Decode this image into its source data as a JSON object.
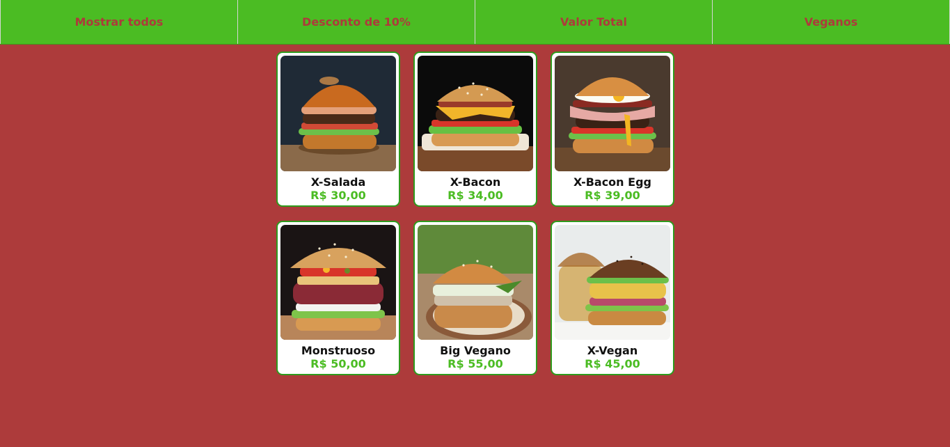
{
  "nav": {
    "buttons": [
      {
        "label": "Mostrar todos"
      },
      {
        "label": "Desconto de 10%"
      },
      {
        "label": "Valor Total"
      },
      {
        "label": "Veganos"
      }
    ]
  },
  "products": [
    {
      "name": "X-Salada",
      "price": "R$ 30,00",
      "image": "burger-salad-image"
    },
    {
      "name": "X-Bacon",
      "price": "R$ 34,00",
      "image": "burger-bacon-image"
    },
    {
      "name": "X-Bacon Egg",
      "price": "R$ 39,00",
      "image": "burger-bacon-egg-image"
    },
    {
      "name": "Monstruoso",
      "price": "R$ 50,00",
      "image": "burger-monster-image"
    },
    {
      "name": "Big Vegano",
      "price": "R$ 55,00",
      "image": "burger-vegan-big-image"
    },
    {
      "name": "X-Vegan",
      "price": "R$ 45,00",
      "image": "burger-vegan-image"
    }
  ],
  "colors": {
    "background": "#ad3b3b",
    "nav": "#4bbc23",
    "nav_text": "#ad3b3b",
    "price": "#4bbc23",
    "card_border": "#2e9a1c"
  }
}
